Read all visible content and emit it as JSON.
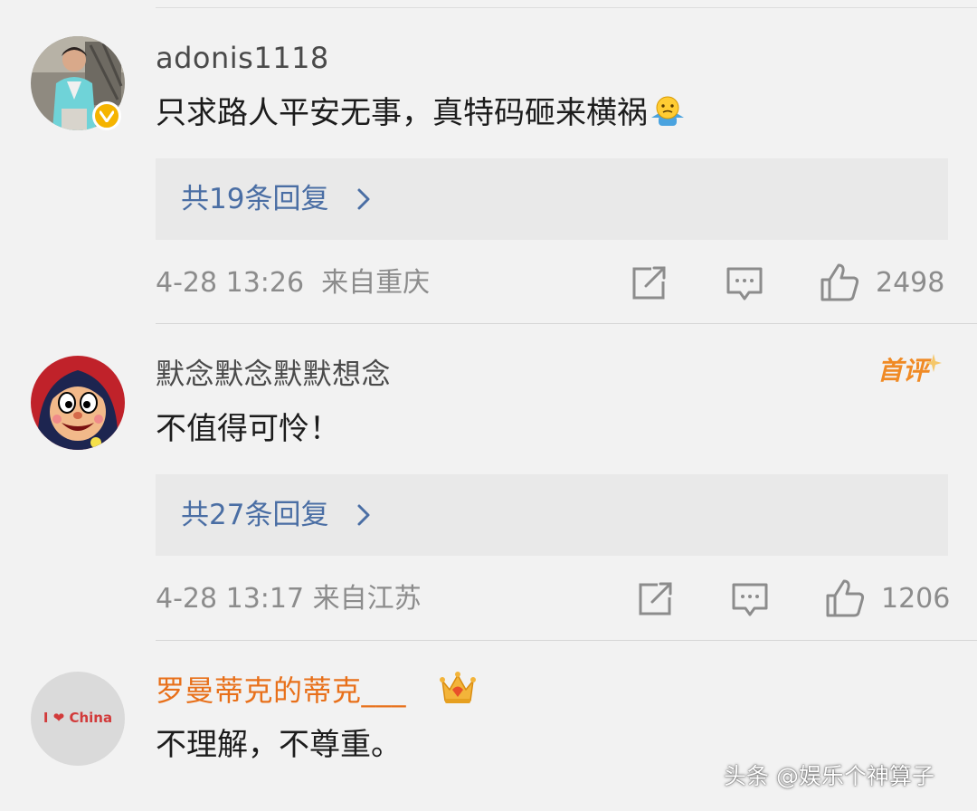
{
  "comments": [
    {
      "username": "adonis1118",
      "text": "只求路人平安无事，真特码砸来横祸",
      "emoji": "shrug-emoji",
      "replies": "共19条回复",
      "time": "4-28 13:26",
      "location": "来自重庆",
      "likes": "2498",
      "verified": true
    },
    {
      "username": "默念默念默默想念",
      "text": "不值得可怜！",
      "badge": "首评",
      "replies": "共27条回复",
      "time": "4-28 13:17",
      "location": "来自江苏",
      "likes": "1206"
    },
    {
      "username": "罗曼蒂克的蒂克___",
      "text": "不理解，不尊重。",
      "avatar_text": "I ❤ China",
      "vip_icon": "crown-icon"
    }
  ],
  "watermark": "头条 @娱乐个神算子",
  "colors": {
    "background": "#f2f2f2",
    "reply_link": "#4a6ea4",
    "vip_name": "#e8701a",
    "badge_orange": "#f08a24",
    "verified_yellow": "#f5b400",
    "meta_gray": "#8c8c8c"
  }
}
